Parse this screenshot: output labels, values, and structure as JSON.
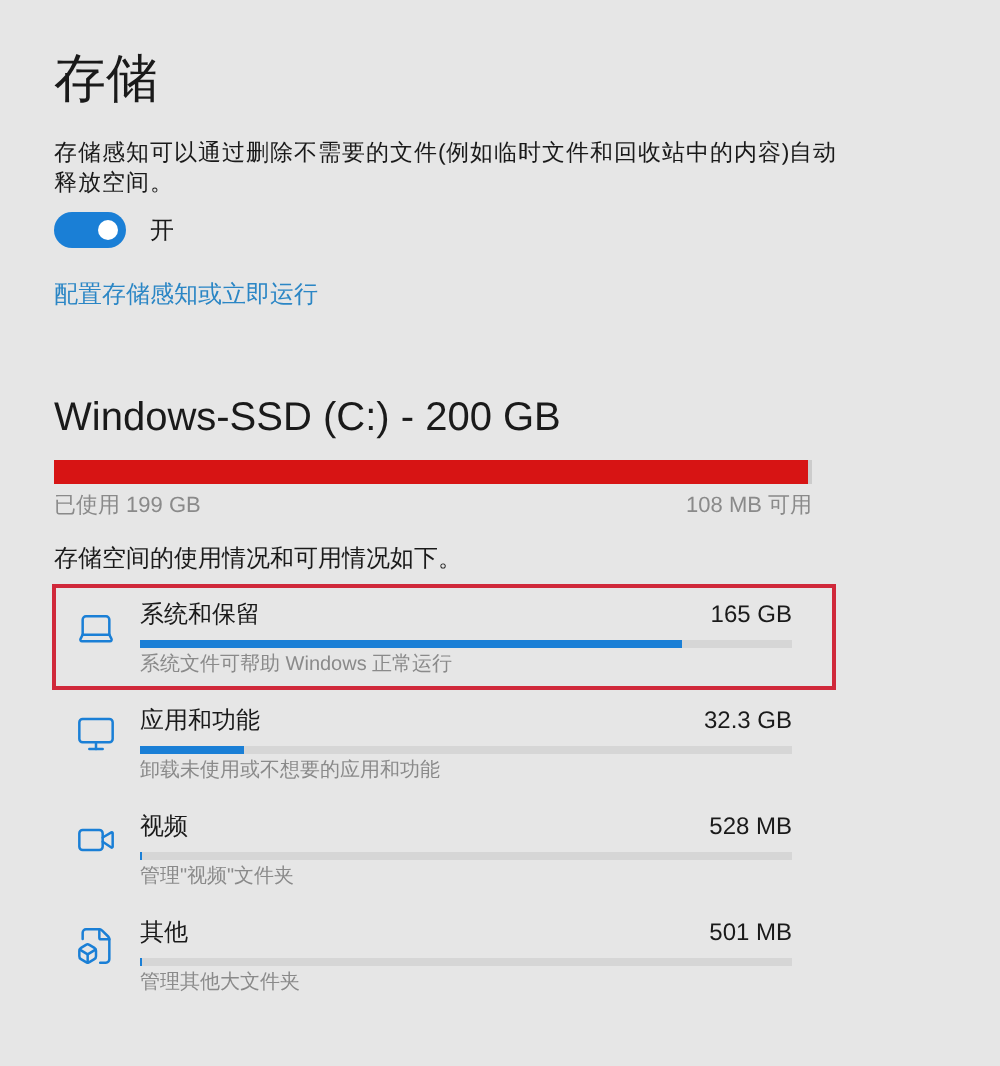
{
  "title": "存储",
  "storage_sense": {
    "description": "存储感知可以通过删除不需要的文件(例如临时文件和回收站中的内容)自动释放空间。",
    "on": true,
    "toggle_label": "开",
    "link": "配置存储感知或立即运行"
  },
  "drive": {
    "title": "Windows-SSD (C:) - 200 GB",
    "level": 0.995,
    "used": "已使用 199 GB",
    "free": "108 MB 可用"
  },
  "usage_heading": "存储空间的使用情况和可用情况如下。",
  "categories": [
    {
      "kind": "system",
      "name": "系统和保留",
      "size": "165 GB",
      "level": 0.83,
      "description": "系统文件可帮助 Windows 正常运行",
      "highlighted": true
    },
    {
      "kind": "apps",
      "name": "应用和功能",
      "size": "32.3 GB",
      "level": 0.16,
      "description": "卸载未使用或不想要的应用和功能",
      "highlighted": false
    },
    {
      "kind": "video",
      "name": "视频",
      "size": "528 MB",
      "level": 0.004,
      "description": "管理\"视频\"文件夹",
      "highlighted": false
    },
    {
      "kind": "other",
      "name": "其他",
      "size": "501 MB",
      "level": 0.004,
      "description": "管理其他大文件夹",
      "highlighted": false
    }
  ]
}
